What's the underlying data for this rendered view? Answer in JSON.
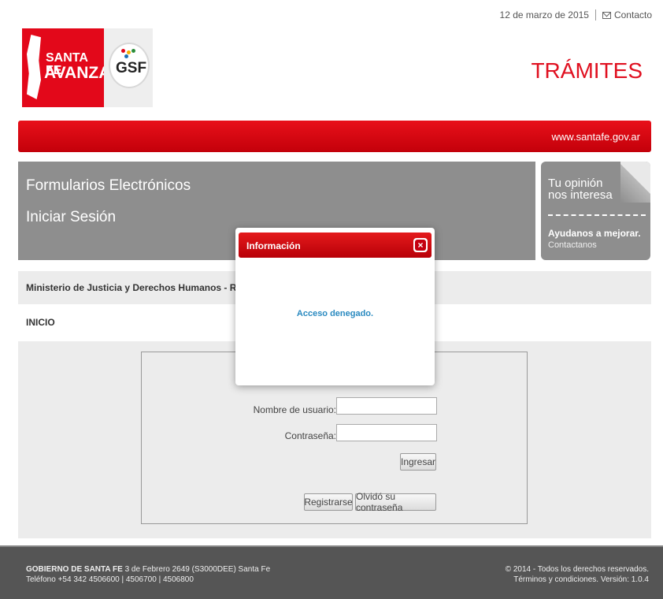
{
  "header": {
    "date": "12 de marzo de 2015",
    "contact_label": "Contacto",
    "logo_line1": "SANTA FE",
    "logo_line2": "AVANZA",
    "gsf_logo": "GSF",
    "section_title": "TRÁMITES"
  },
  "redbar": {
    "site": "www.santafe.gov.ar"
  },
  "title_panel": {
    "title": "Formularios Electrónicos",
    "subtitle": "Iniciar Sesión"
  },
  "opinion": {
    "line1": "Tu opinión",
    "line2": "nos interesa",
    "cta": "Ayudanos a mejorar.",
    "link": "Contactanos"
  },
  "breadcrumb": {
    "ministry": "Ministerio de Justicia y Derechos Humanos - Registro de la P",
    "inicio": "INICIO"
  },
  "login": {
    "username_label": "Nombre de usuario:",
    "username_value": "",
    "password_label": "Contraseña:",
    "password_value": "",
    "submit_label": "Ingresar",
    "register_label": "Registrarse",
    "forgot_label": "Olvidó su contraseña"
  },
  "footer": {
    "left1_bold": "GOBIERNO DE SANTA FE",
    "left1_rest": " 3 de Febrero 2649 (S3000DEE) Santa Fe",
    "left2": "Teléfono +54 342 4506600 | 4506700 | 4506800",
    "right1": "© 2014 - Todos los derechos reservados.",
    "right2": "Términos y condiciones. Versión: 1.0.4"
  },
  "modal": {
    "title": "Información",
    "message": "Acceso denegado.",
    "close_glyph": "×"
  },
  "colors": {
    "brand_red": "#e3081a",
    "panel_grey": "#8e8e8e",
    "message_blue": "#2a8ac0"
  }
}
